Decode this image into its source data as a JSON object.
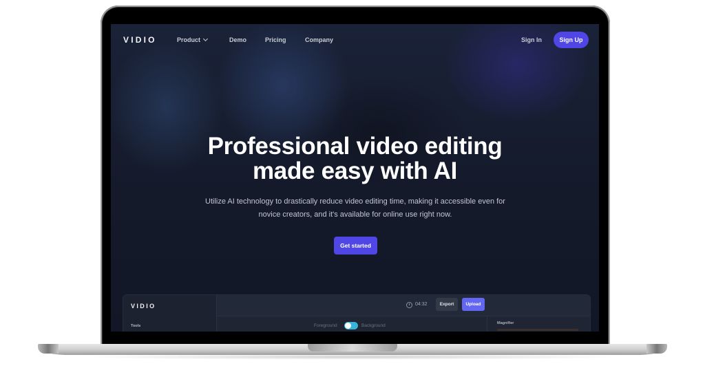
{
  "nav": {
    "logo": "VIDIO",
    "links": [
      {
        "label": "Product",
        "has_dropdown": true
      },
      {
        "label": "Demo"
      },
      {
        "label": "Pricing"
      },
      {
        "label": "Company"
      }
    ],
    "sign_in": "Sign In",
    "sign_up": "Sign Up"
  },
  "hero": {
    "title_line1": "Professional video editing",
    "title_line2": "made easy with AI",
    "subtitle_line1": "Utilize AI technology to drastically reduce video editing time, making it accessible even for",
    "subtitle_line2": "novice creators, and it's available for online use right now.",
    "cta": "Get started"
  },
  "app_preview": {
    "logo": "VIDIO",
    "sidebar_section": "Tools",
    "time": "04:32",
    "export": "Export",
    "upload": "Upload",
    "toggle_left": "Foreground",
    "toggle_right": "Background",
    "toggle_on": true,
    "panel_title": "Magnifier"
  },
  "colors": {
    "accent": "#4f46e5",
    "upload": "#6366f1",
    "toggle": "#38b2d8",
    "background": "#141a2a"
  }
}
